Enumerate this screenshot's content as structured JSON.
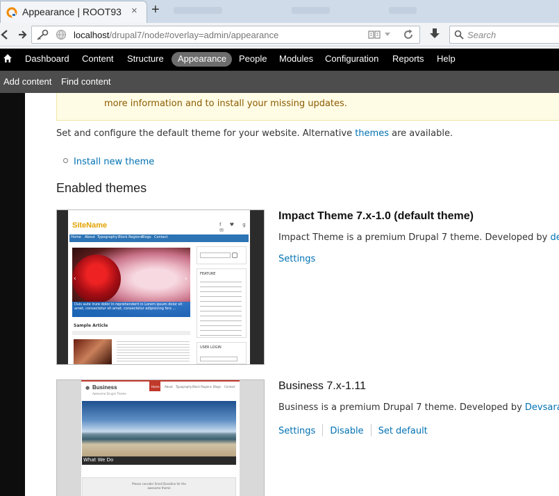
{
  "browser": {
    "tab_title": "Appearance | ROOT93",
    "close_glyph": "×",
    "new_tab_glyph": "+",
    "url_host": "localhost",
    "url_rest": "/drupal7/node#overlay=admin/appearance",
    "search_placeholder": "Search",
    "icons": [
      "back-icon",
      "forward-icon",
      "identity-key-icon",
      "globe-icon",
      "reader-icon",
      "dropdown-icon",
      "reload-icon",
      "download-icon",
      "search-icon"
    ]
  },
  "toolbar": {
    "items": [
      "Dashboard",
      "Content",
      "Structure",
      "Appearance",
      "People",
      "Modules",
      "Configuration",
      "Reports",
      "Help"
    ],
    "active": "Appearance"
  },
  "shortcuts": [
    "Add content",
    "Find content"
  ],
  "page": {
    "warning_text": "more information and to install your missing updates.",
    "intro_before": "Set and configure the default theme for your website. Alternative ",
    "intro_link": "themes",
    "intro_after": " are available.",
    "install_link": "Install new theme",
    "section_title": "Enabled themes"
  },
  "themes": [
    {
      "name": "Impact Theme 7.x-1.0 (default theme)",
      "desc_before": "Impact Theme is a premium Drupal 7 theme. Developed by ",
      "desc_link": "devs",
      "links": [
        "Settings"
      ],
      "preview": {
        "site_name": "SiteName",
        "nav": [
          "Home",
          "About",
          "Typography",
          "Block Regions",
          "Blogs",
          "Contact"
        ],
        "caption": "Duis aute irure dolor in reprehenderit in Lorem ipsum dolor sit amet, consectetur sit amet, consectetur adipisicing fers ...",
        "article": "Sample Article",
        "sidebar_title": "FEATURE",
        "login": "USER LOGIN"
      }
    },
    {
      "name": "Business 7.x-1.11",
      "desc_before": "Business is a premium Drupal 7 theme. Developed by ",
      "desc_link": "Devsaran.",
      "links": [
        "Settings",
        "Disable",
        "Set default"
      ],
      "preview": {
        "site_name": "Business",
        "tagline": "Awesome Drupal Theme",
        "nav": [
          "Home",
          "About",
          "Typography",
          "Block Regions",
          "Blogs",
          "Contact"
        ],
        "caption": "What We Do",
        "donation": "Please consider Small Donation for the awesome theme"
      }
    }
  ],
  "colors": {
    "link": "#0071b3",
    "toolbar": "#000000",
    "shortcut_bar": "#4d4d4d",
    "warning_bg": "#fffce5"
  }
}
